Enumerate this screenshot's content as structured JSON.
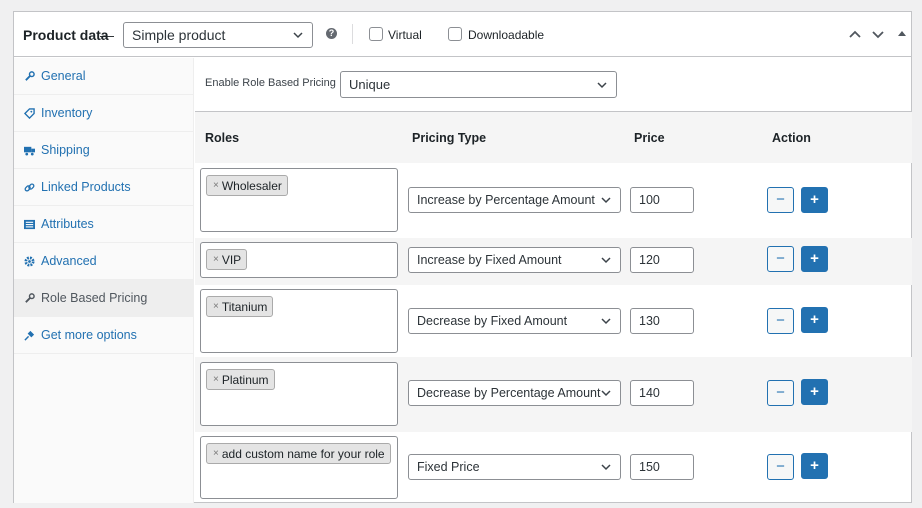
{
  "header": {
    "title": "Product data",
    "dash": "—",
    "product_type": "Simple product",
    "virtual_label": "Virtual",
    "downloadable_label": "Downloadable"
  },
  "tabs": [
    {
      "label": "General",
      "icon": "wrench-icon"
    },
    {
      "label": "Inventory",
      "icon": "tag-icon"
    },
    {
      "label": "Shipping",
      "icon": "truck-icon"
    },
    {
      "label": "Linked Products",
      "icon": "link-icon"
    },
    {
      "label": "Attributes",
      "icon": "list-icon"
    },
    {
      "label": "Advanced",
      "icon": "gear-icon"
    },
    {
      "label": "Role Based Pricing",
      "icon": "wrench-icon",
      "active": true
    },
    {
      "label": "Get more options",
      "icon": "plugin-icon"
    }
  ],
  "enable": {
    "label": "Enable Role Based Pricing",
    "value": "Unique"
  },
  "table": {
    "headers": {
      "roles": "Roles",
      "pricing_type": "Pricing Type",
      "price": "Price",
      "action": "Action"
    },
    "rows": [
      {
        "role": "Wholesaler",
        "pricing_type": "Increase by Percentage Amount",
        "price": "100"
      },
      {
        "role": "VIP",
        "pricing_type": "Increase by Fixed Amount",
        "price": "120"
      },
      {
        "role": "Titanium",
        "pricing_type": "Decrease by Fixed Amount",
        "price": "130"
      },
      {
        "role": "Platinum",
        "pricing_type": "Decrease by Percentage Amount",
        "price": "140"
      },
      {
        "role": "add custom name for your role",
        "pricing_type": "Fixed Price",
        "price": "150"
      }
    ],
    "minus_label": "−",
    "plus_label": "+",
    "remove_symbol": "×"
  },
  "colors": {
    "accent": "#2271b1",
    "border": "#c3c4c7",
    "row_alt": "#f5f5f5"
  }
}
